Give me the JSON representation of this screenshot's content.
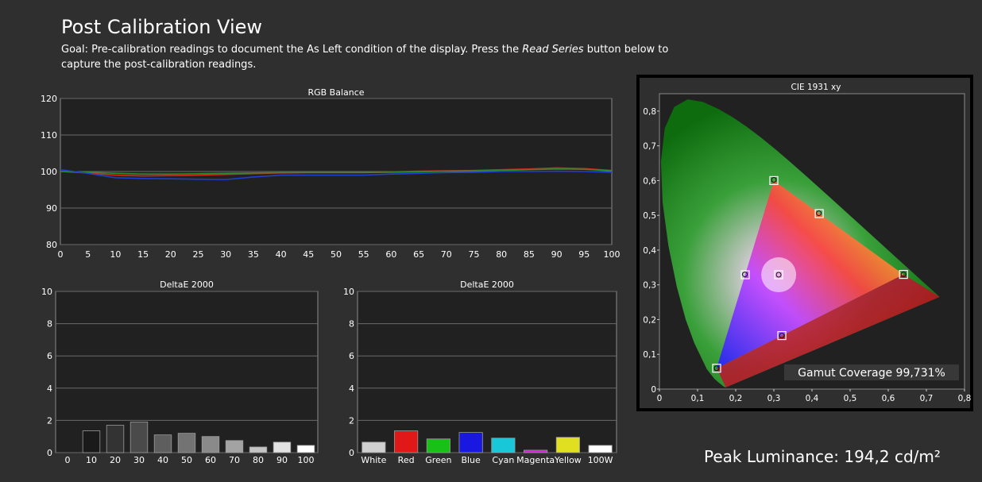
{
  "page": {
    "title": "Post Calibration View",
    "goal_prefix": "Goal: Pre-calibration readings to document the As Left condition of the display. Press the ",
    "goal_emph": "Read Series",
    "goal_suffix": " button below to capture the post-calibration readings.",
    "peak_luminance": "Peak Luminance: 194,2 cd/m²",
    "gamut_coverage": "Gamut Coverage 99,731%"
  },
  "colors": {
    "plot_bg": "#212121",
    "grid": "#6a6a6a",
    "red": "#d7261e",
    "green": "#2e8b2e",
    "blue": "#1f3fd0"
  },
  "chart_data": [
    {
      "id": "rgb",
      "type": "line",
      "title": "RGB Balance",
      "x": [
        0,
        5,
        10,
        15,
        20,
        25,
        30,
        35,
        40,
        45,
        50,
        55,
        60,
        65,
        70,
        75,
        80,
        85,
        90,
        95,
        100
      ],
      "xlim": [
        0,
        100
      ],
      "ylim": [
        80,
        120
      ],
      "yticks": [
        80,
        90,
        100,
        110,
        120
      ],
      "series": [
        {
          "color": "red",
          "values": [
            100,
            99.6,
            99.0,
            98.8,
            98.9,
            99.0,
            99.2,
            99.4,
            99.6,
            99.7,
            99.7,
            99.7,
            99.9,
            100.1,
            100.2,
            100.3,
            100.5,
            100.7,
            101.0,
            100.8,
            100.3
          ]
        },
        {
          "color": "green",
          "values": [
            100,
            99.8,
            99.5,
            99.3,
            99.3,
            99.4,
            99.5,
            99.6,
            99.7,
            99.7,
            99.7,
            99.7,
            99.8,
            99.9,
            100.1,
            100.2,
            100.3,
            100.5,
            100.7,
            100.6,
            100.2
          ]
        },
        {
          "color": "blue",
          "values": [
            100.5,
            99.5,
            98.3,
            98.1,
            98.0,
            97.9,
            97.8,
            98.5,
            99.0,
            99.0,
            99.0,
            99.0,
            99.3,
            99.5,
            99.7,
            99.8,
            100.0,
            100.0,
            100.1,
            100.0,
            99.8
          ]
        }
      ],
      "grid": true
    },
    {
      "id": "de_gray",
      "type": "bar",
      "title": "DeltaE 2000",
      "categories": [
        "0",
        "10",
        "20",
        "30",
        "40",
        "50",
        "60",
        "70",
        "80",
        "90",
        "100"
      ],
      "values": [
        0,
        1.35,
        1.7,
        1.9,
        1.1,
        1.2,
        1.0,
        0.75,
        0.35,
        0.65,
        0.45
      ],
      "bar_colors": [
        "#000000",
        "#1a1a1a",
        "#333333",
        "#4a4a4a",
        "#5e5e5e",
        "#737373",
        "#8a8a8a",
        "#a3a3a3",
        "#c4c4c4",
        "#e2e2e2",
        "#ffffff"
      ],
      "ylim": [
        0,
        10
      ],
      "yticks": [
        0,
        2,
        4,
        6,
        8,
        10
      ],
      "grid": true
    },
    {
      "id": "de_color",
      "type": "bar",
      "title": "DeltaE 2000",
      "categories": [
        "White",
        "Red",
        "Green",
        "Blue",
        "Cyan",
        "Magenta",
        "Yellow",
        "100W"
      ],
      "values": [
        0.65,
        1.35,
        0.85,
        1.25,
        0.9,
        0.15,
        0.95,
        0.45
      ],
      "bar_colors": [
        "#d0d0d0",
        "#e01818",
        "#18c018",
        "#1818e0",
        "#18c8d8",
        "#d020d0",
        "#e0e020",
        "#ffffff"
      ],
      "ylim": [
        0,
        10
      ],
      "yticks": [
        0,
        2,
        4,
        6,
        8,
        10
      ],
      "grid": true
    },
    {
      "id": "cie",
      "type": "scatter",
      "title": "CIE 1931 xy",
      "xlim": [
        0,
        0.8
      ],
      "ylim": [
        0,
        0.85
      ],
      "xticks": [
        "0",
        "0,1",
        "0,2",
        "0,3",
        "0,4",
        "0,5",
        "0,6",
        "0,7",
        "0,8"
      ],
      "yticks": [
        "0",
        "0,1",
        "0,2",
        "0,3",
        "0,4",
        "0,5",
        "0,6",
        "0,7",
        "0,8"
      ],
      "gamut": [
        [
          0.64,
          0.33
        ],
        [
          0.3,
          0.6
        ],
        [
          0.15,
          0.06
        ]
      ],
      "targets": [
        {
          "x": 0.64,
          "y": 0.33
        },
        {
          "x": 0.3,
          "y": 0.6
        },
        {
          "x": 0.15,
          "y": 0.06
        },
        {
          "x": 0.225,
          "y": 0.329
        },
        {
          "x": 0.321,
          "y": 0.154
        },
        {
          "x": 0.419,
          "y": 0.505
        },
        {
          "x": 0.3127,
          "y": 0.329
        }
      ],
      "measured": [
        {
          "x": 0.64,
          "y": 0.33
        },
        {
          "x": 0.3,
          "y": 0.602
        },
        {
          "x": 0.15,
          "y": 0.06
        },
        {
          "x": 0.224,
          "y": 0.33
        },
        {
          "x": 0.321,
          "y": 0.154
        },
        {
          "x": 0.418,
          "y": 0.506
        },
        {
          "x": 0.3127,
          "y": 0.329
        }
      ]
    }
  ]
}
